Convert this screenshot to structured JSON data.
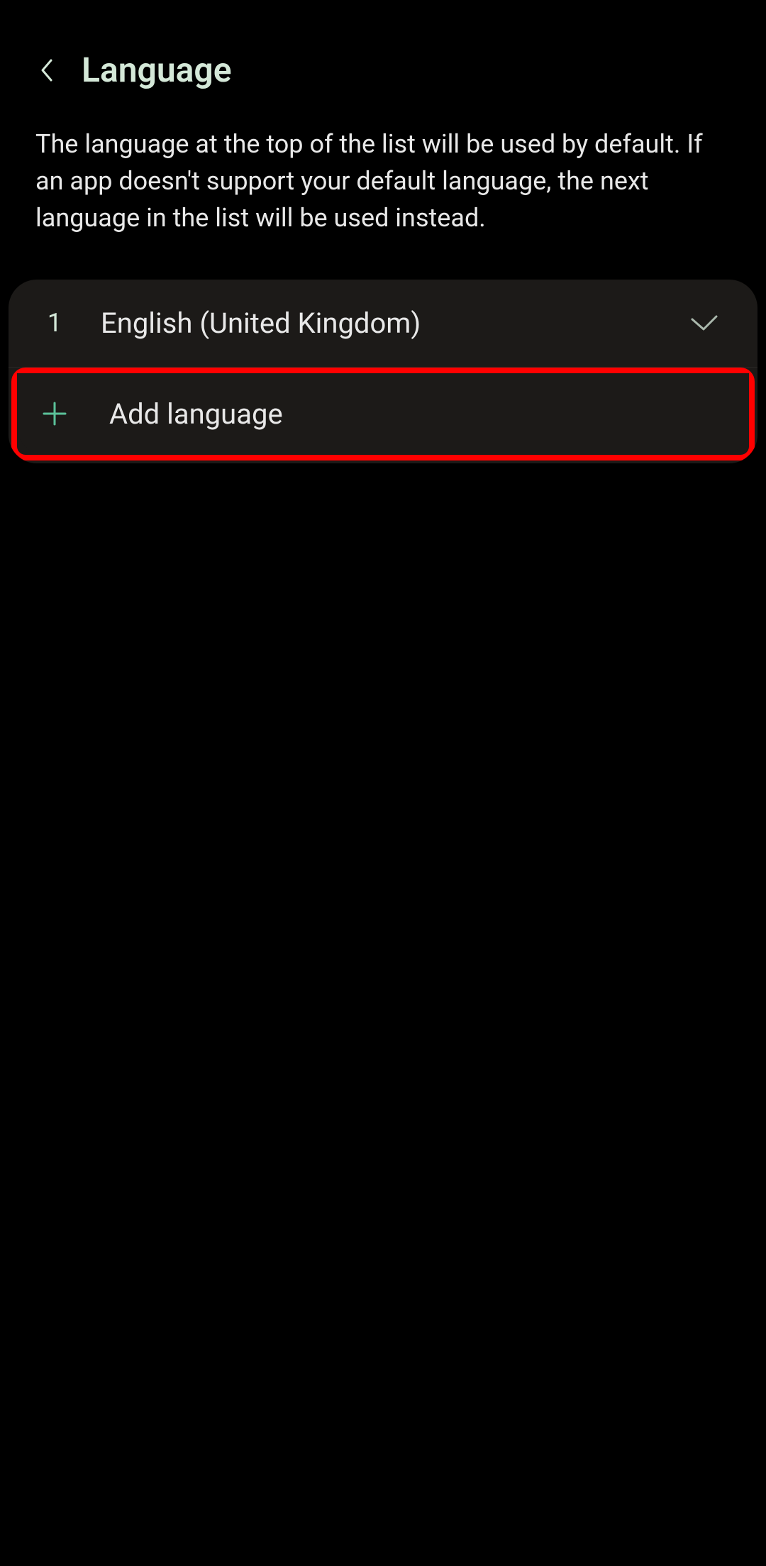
{
  "header": {
    "title": "Language"
  },
  "description": "The language at the top of the list will be used by default. If an app doesn't support your default language, the next language in the list will be used instead.",
  "languages": [
    {
      "index": "1",
      "name": "English (United Kingdom)",
      "selected": true
    }
  ],
  "addLanguage": {
    "label": "Add language"
  },
  "colors": {
    "accent": "#d4e8d8",
    "plusIcon": "#5bc29a",
    "highlight": "#ff0000"
  }
}
